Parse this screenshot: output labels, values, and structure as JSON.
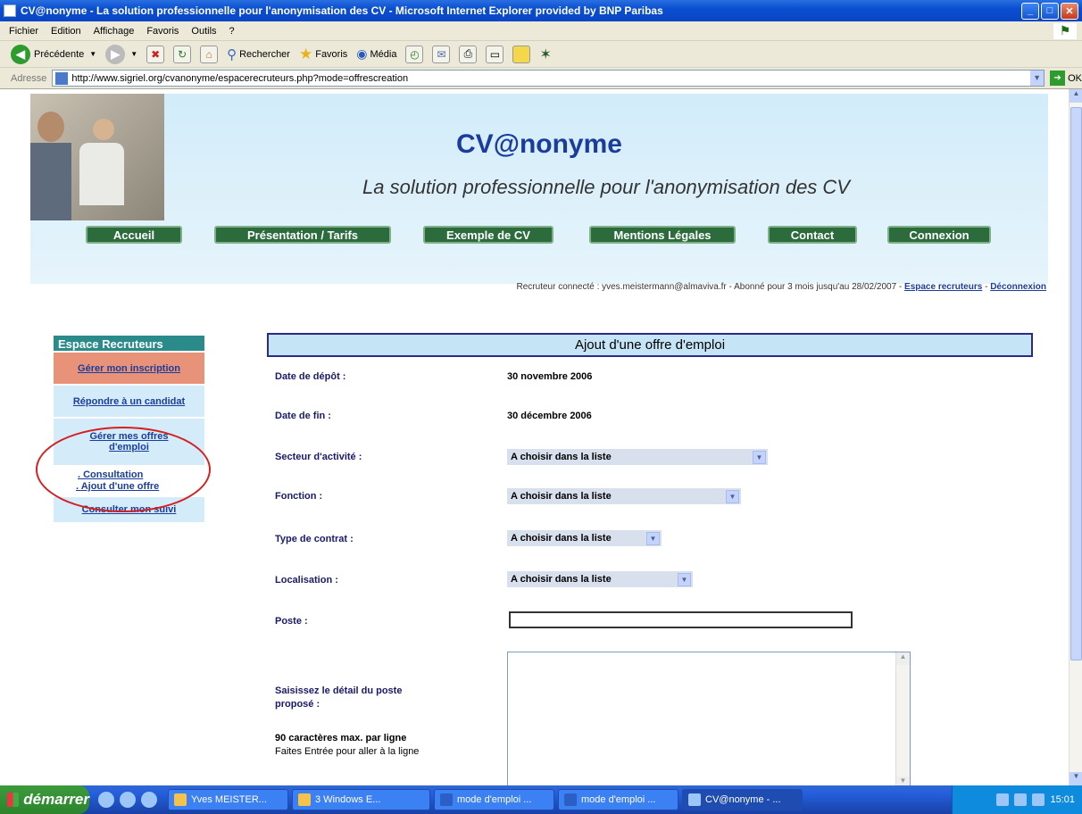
{
  "window": {
    "title": "CV@nonyme - La solution professionnelle pour l'anonymisation des CV - Microsoft Internet Explorer provided by BNP Paribas"
  },
  "menu": [
    "Fichier",
    "Edition",
    "Affichage",
    "Favoris",
    "Outils",
    "?"
  ],
  "toolbar": {
    "back": "Précédente",
    "search": "Rechercher",
    "favorites": "Favoris",
    "media": "Média"
  },
  "address": {
    "label": "Adresse",
    "url": "http://www.sigriel.org/cvanonyme/espacerecruteurs.php?mode=offrescreation",
    "go": "OK"
  },
  "site": {
    "title": "CV@nonyme",
    "subtitle": "La solution professionnelle pour l'anonymisation des CV",
    "nav": [
      "Accueil",
      "Présentation / Tarifs",
      "Exemple de CV",
      "Mentions Légales",
      "Contact",
      "Connexion"
    ],
    "login_text": "Recruteur connecté : yves.meistermann@almaviva.fr - Abonné pour 3 mois jusqu'au 28/02/2007 - ",
    "espace_link": "Espace recruteurs",
    "sep": " - ",
    "logout_link": "Déconnexion"
  },
  "sidebar": {
    "heading": "Espace Recruteurs",
    "items": [
      "Gérer mon inscription",
      "Répondre à un candidat",
      "Gérer mes offres d'emploi"
    ],
    "subitems": [
      ". Consultation",
      ". Ajout d'une offre"
    ],
    "last": "Consulter mon suivi"
  },
  "form": {
    "heading": "Ajout d'une offre d'emploi",
    "date_depot_label": "Date de dépôt :",
    "date_depot": "30 novembre 2006",
    "date_fin_label": "Date de fin :",
    "date_fin": "30 décembre 2006",
    "secteur_label": "Secteur d'activité :",
    "fonction_label": "Fonction :",
    "contrat_label": "Type de contrat :",
    "localisation_label": "Localisation :",
    "select_placeholder": "A choisir dans la liste",
    "poste_label": "Poste :",
    "detail_label": "Saisissez le détail du poste proposé :",
    "note1": "90 caractères max. par ligne",
    "note2": "Faites Entrée pour aller à la ligne"
  },
  "taskbar": {
    "start": "démarrer",
    "tasks": [
      "Yves MEISTER...",
      "3 Windows E...",
      "mode d'emploi ...",
      "mode d'emploi ...",
      "CV@nonyme - ..."
    ],
    "clock": "15:01"
  }
}
